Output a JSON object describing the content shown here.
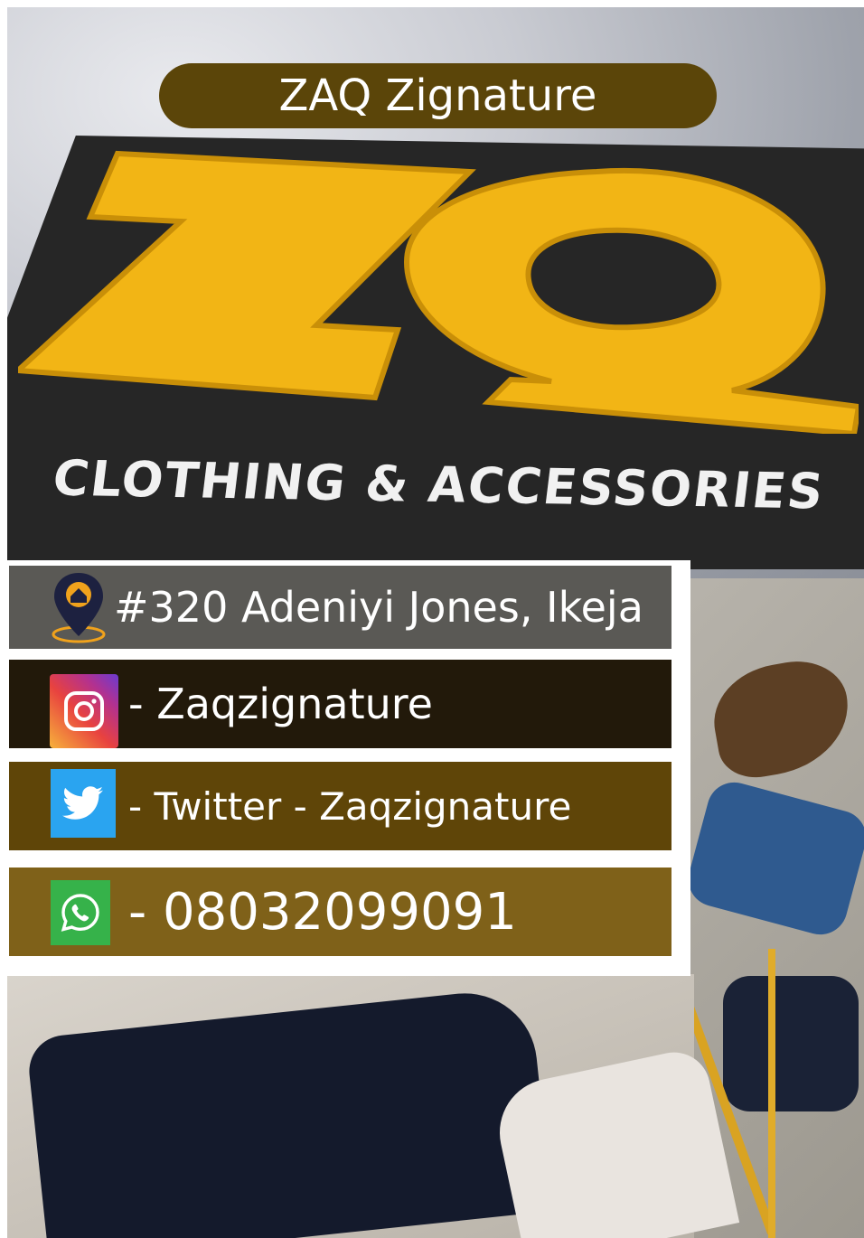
{
  "title": "ZAQ Zignature",
  "logo": {
    "text": "ZQ",
    "tagline": "CLOTHING & ACCESSORIES"
  },
  "contacts": {
    "address": "#320 Adeniyi Jones, Ikeja",
    "instagram": "- Zaqzignature",
    "twitter": "- Twitter - Zaqzignature",
    "whatsapp": "- 08032099091"
  },
  "icons": {
    "address": "location-pin-icon",
    "instagram": "instagram-icon",
    "twitter": "twitter-icon",
    "whatsapp": "whatsapp-icon"
  },
  "colors": {
    "title_pill": "#5b4509",
    "logo_yellow": "#f2b515",
    "row_address": "#5a5955",
    "row_instagram": "#22190a",
    "row_twitter": "#5f4508",
    "row_whatsapp": "#7f6119"
  }
}
